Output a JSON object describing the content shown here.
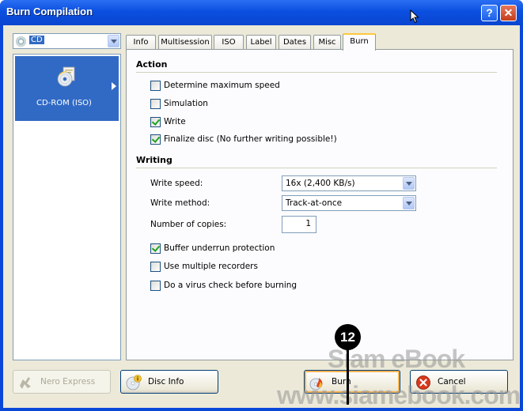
{
  "window": {
    "title": "Burn Compilation",
    "help_label": "?",
    "close_label": "✕"
  },
  "sidebar": {
    "combo_value": "CD",
    "item_label": "CD-ROM (ISO)"
  },
  "tabs": [
    {
      "label": "Info"
    },
    {
      "label": "Multisession"
    },
    {
      "label": "ISO"
    },
    {
      "label": "Label"
    },
    {
      "label": "Dates"
    },
    {
      "label": "Misc"
    },
    {
      "label": "Burn",
      "active": true
    }
  ],
  "action": {
    "title": "Action",
    "options": [
      {
        "label": "Determine maximum speed",
        "checked": false
      },
      {
        "label": "Simulation",
        "checked": false
      },
      {
        "label": "Write",
        "checked": true
      },
      {
        "label": "Finalize disc (No further writing possible!)",
        "checked": true
      }
    ]
  },
  "writing": {
    "title": "Writing",
    "speed_label": "Write speed:",
    "speed_value": "16x (2,400 KB/s)",
    "method_label": "Write method:",
    "method_value": "Track-at-once",
    "copies_label": "Number of copies:",
    "copies_value": "1",
    "options": [
      {
        "label": "Buffer underrun protection",
        "checked": true
      },
      {
        "label": "Use multiple recorders",
        "checked": false
      },
      {
        "label": "Do a virus check before burning",
        "checked": false
      }
    ]
  },
  "buttons": {
    "nero_express": "Nero Express",
    "disc_info": "Disc Info",
    "burn": "Burn",
    "cancel": "Cancel"
  },
  "annotation": {
    "step": "12",
    "watermark_1": "Siam eBook",
    "watermark_2": "www.siamebook.com"
  },
  "colors": {
    "titlebar": "#0a47d8",
    "selection": "#316ac5",
    "checkmark": "#21a121",
    "active_tab": "#ffc83c"
  }
}
